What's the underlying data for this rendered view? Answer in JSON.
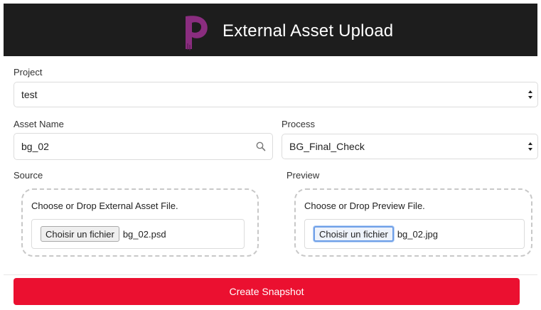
{
  "header": {
    "title": "External Asset Upload",
    "logo_icon": "p-brand-logo-icon"
  },
  "colors": {
    "header_bg": "#1d1d1d",
    "logo": "#8a2d7f",
    "submit_bg": "#eb1030",
    "focus_ring": "#6fa0e8"
  },
  "project": {
    "label": "Project",
    "selected": "test"
  },
  "asset_name": {
    "label": "Asset Name",
    "value": "bg_02",
    "icon": "search-icon"
  },
  "process": {
    "label": "Process",
    "selected": "BG_Final_Check"
  },
  "source": {
    "label": "Source",
    "prompt": "Choose or Drop External Asset File.",
    "button_label": "Choisir un fichier",
    "file_name": "bg_02.psd"
  },
  "preview": {
    "label": "Preview",
    "prompt": "Choose or Drop Preview File.",
    "button_label": "Choisir un fichier",
    "file_name": "bg_02.jpg"
  },
  "submit": {
    "label": "Create Snapshot"
  }
}
